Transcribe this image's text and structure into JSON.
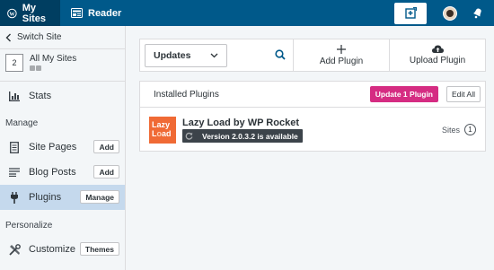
{
  "topbar": {
    "my_sites": "My Sites",
    "reader": "Reader",
    "accent": "#00598a"
  },
  "sidebar": {
    "switch_site": "Switch Site",
    "site": {
      "count": "2",
      "name": "All My Sites"
    },
    "stats": "Stats",
    "manage_header": "Manage",
    "site_pages": "Site Pages",
    "site_pages_btn": "Add",
    "blog_posts": "Blog Posts",
    "blog_posts_btn": "Add",
    "plugins": "Plugins",
    "plugins_btn": "Manage",
    "personalize_header": "Personalize",
    "customize": "Customize",
    "customize_btn": "Themes"
  },
  "main": {
    "filter_selected": "Updates",
    "add_plugin": "Add Plugin",
    "upload_plugin": "Upload Plugin",
    "installed_title": "Installed Plugins",
    "update_button": "Update 1 Plugin",
    "edit_all": "Edit All",
    "plugin": {
      "logo_line1": "Lazy",
      "logo_line2a": "L",
      "logo_line2b": "o",
      "logo_line2c": "ad",
      "name": "Lazy Load by WP Rocket",
      "update_text": "Version 2.0.3.2 is available",
      "sites_label": "Sites",
      "sites_count": "1"
    }
  }
}
